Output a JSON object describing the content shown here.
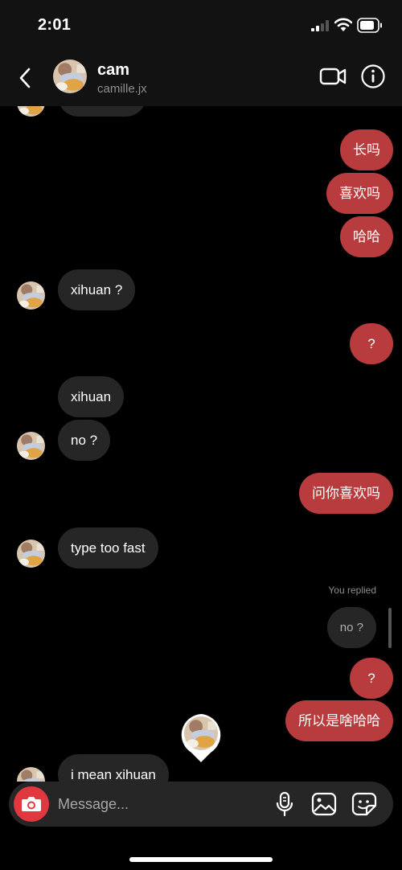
{
  "status_bar": {
    "time": "2:01"
  },
  "header": {
    "name": "cam",
    "username": "camille.jx"
  },
  "messages": [
    {
      "side": "in",
      "text": ""
    },
    {
      "side": "out",
      "text": "长吗"
    },
    {
      "side": "out",
      "text": "喜欢吗"
    },
    {
      "side": "out",
      "text": "哈哈"
    },
    {
      "side": "in",
      "text": "xihuan ?"
    },
    {
      "side": "out",
      "text": "?"
    },
    {
      "side": "in",
      "text": "xihuan"
    },
    {
      "side": "in",
      "text": "no ?"
    },
    {
      "side": "out",
      "text": "问你喜欢吗"
    },
    {
      "side": "in",
      "text": "type too fast"
    },
    {
      "side": "out",
      "text": "?"
    },
    {
      "side": "out",
      "text": "所以是啥哈哈"
    },
    {
      "side": "in",
      "text": "i mean xihuan"
    }
  ],
  "reply": {
    "label": "You replied",
    "quoted": "no ?"
  },
  "composer": {
    "placeholder": "Message..."
  },
  "colors": {
    "outgoing": "#b83b3d",
    "incoming": "#262626",
    "background": "#000000",
    "camera": "#e0383e"
  },
  "icons": [
    "back-chevron-icon",
    "video-call-icon",
    "info-icon",
    "camera-icon",
    "microphone-icon",
    "gallery-icon",
    "sticker-icon"
  ]
}
